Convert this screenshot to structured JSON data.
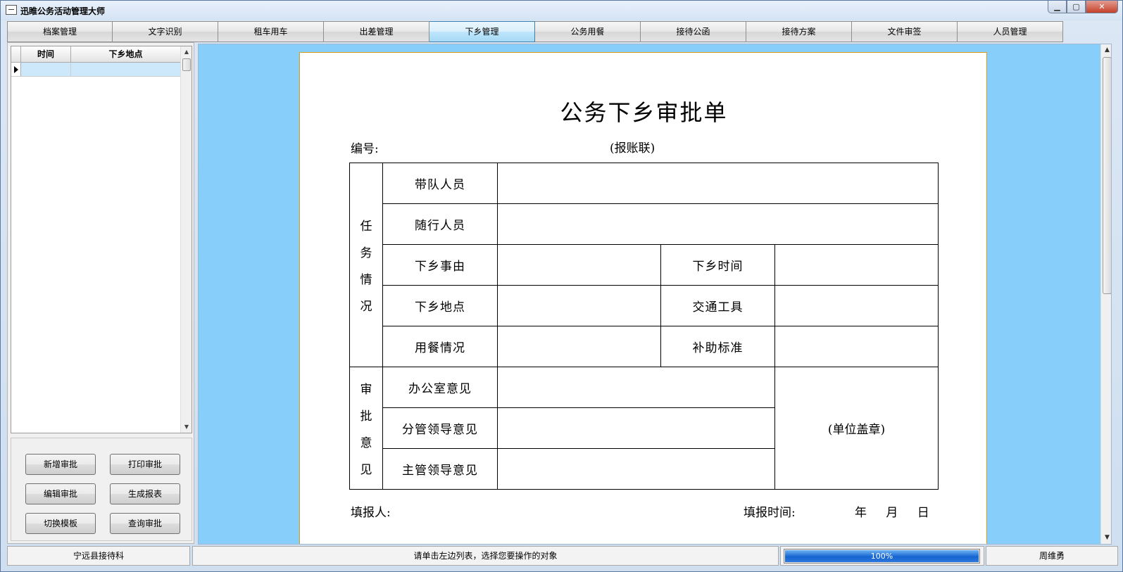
{
  "window": {
    "title": "迅睢公务活动管理大师"
  },
  "tabs": [
    {
      "label": "档案管理",
      "active": false
    },
    {
      "label": "文字识别",
      "active": false
    },
    {
      "label": "租车用车",
      "active": false
    },
    {
      "label": "出差管理",
      "active": false
    },
    {
      "label": "下乡管理",
      "active": true
    },
    {
      "label": "公务用餐",
      "active": false
    },
    {
      "label": "接待公函",
      "active": false
    },
    {
      "label": "接待方案",
      "active": false
    },
    {
      "label": "文件审签",
      "active": false
    },
    {
      "label": "人员管理",
      "active": false
    }
  ],
  "list": {
    "columns": [
      "时间",
      "下乡地点"
    ],
    "rows": [
      [
        "",
        ""
      ]
    ]
  },
  "buttons": {
    "new_approval": "新增审批",
    "print_approval": "打印审批",
    "edit_approval": "编辑审批",
    "generate_report": "生成报表",
    "switch_template": "切换模板",
    "query_approval": "查询审批"
  },
  "document": {
    "title": "公务下乡审批单",
    "number_label": "编号:",
    "copy_label": "(报账联)",
    "section_task": [
      "任",
      "务",
      "情",
      "况"
    ],
    "section_opinion": [
      "审",
      "批",
      "意",
      "见"
    ],
    "leader": "带队人员",
    "companions": "随行人员",
    "reason": "下乡事由",
    "time": "下乡时间",
    "location": "下乡地点",
    "transport": "交通工具",
    "meals": "用餐情况",
    "subsidy": "补助标准",
    "office_opinion": "办公室意见",
    "charge_leader_opinion": "分管领导意见",
    "main_leader_opinion": "主管领导意见",
    "seal": "(单位盖章)",
    "filler_label": "填报人:",
    "fill_time_label": "填报时间:",
    "date_template": "年 月 日"
  },
  "statusbar": {
    "unit": "宁远县接待科",
    "hint": "请单击左边列表，选择您要操作的对象",
    "progress_text": "100%",
    "progress_value": 1.0,
    "user": "周维勇"
  },
  "colors": {
    "main_background": "#87cefa",
    "paper_border": "#d79b1a",
    "selected_row": "#cde8fa",
    "progress": "#1564cf"
  }
}
